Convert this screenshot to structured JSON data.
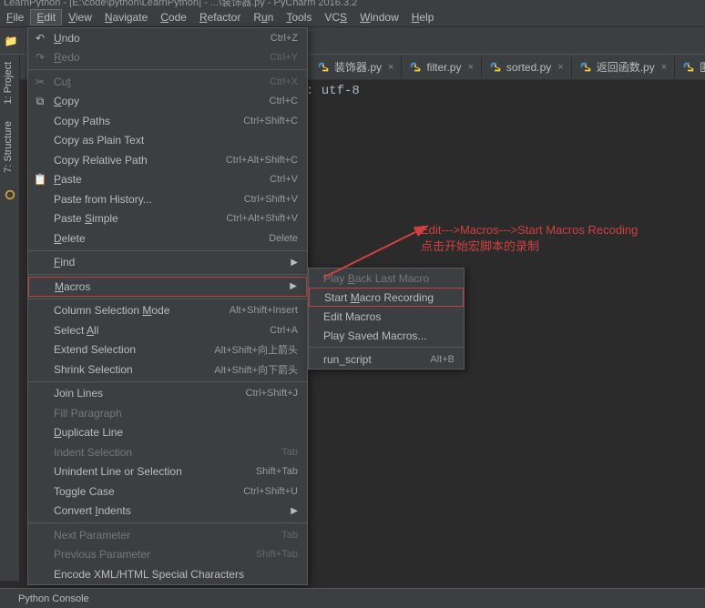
{
  "title": "LearnPython - [E:\\code\\python\\LearnPython] - ...\\装饰器.py - PyCharm 2016.3.2",
  "menubar": [
    "File",
    "Edit",
    "View",
    "Navigate",
    "Code",
    "Refactor",
    "Run",
    "Tools",
    "VCS",
    "Window",
    "Help"
  ],
  "menubar_underline": [
    "F",
    "E",
    "V",
    "N",
    "C",
    "R",
    "u",
    "T",
    "S",
    "W",
    "H"
  ],
  "tabs": [
    {
      "label": "装饰器.py"
    },
    {
      "label": "filter.py"
    },
    {
      "label": "sorted.py"
    },
    {
      "label": "返回函数.py"
    },
    {
      "label": "匿"
    }
  ],
  "editor_text": ": utf-8",
  "sidebar": {
    "project": "1: Project",
    "structure": "7: Structure"
  },
  "bottom": {
    "console": "Python Console"
  },
  "edit_menu": [
    {
      "label": "Undo",
      "u": "U",
      "shortcut": "Ctrl+Z",
      "icon": "undo",
      "sep": false
    },
    {
      "label": "Redo",
      "u": "R",
      "shortcut": "Ctrl+Y",
      "icon": "redo",
      "disabled": true,
      "sep": true
    },
    {
      "label": "Cut",
      "u": "t",
      "shortcut": "Ctrl+X",
      "icon": "cut",
      "disabled": true
    },
    {
      "label": "Copy",
      "u": "C",
      "shortcut": "Ctrl+C",
      "icon": "copy"
    },
    {
      "label": "Copy Paths",
      "shortcut": "Ctrl+Shift+C"
    },
    {
      "label": "Copy as Plain Text"
    },
    {
      "label": "Copy Relative Path",
      "shortcut": "Ctrl+Alt+Shift+C"
    },
    {
      "label": "Paste",
      "u": "P",
      "shortcut": "Ctrl+V",
      "icon": "paste"
    },
    {
      "label": "Paste from History...",
      "shortcut": "Ctrl+Shift+V"
    },
    {
      "label": "Paste Simple",
      "u": "S",
      "shortcut": "Ctrl+Alt+Shift+V"
    },
    {
      "label": "Delete",
      "u": "D",
      "shortcut": "Delete",
      "sep": true
    },
    {
      "label": "Find",
      "u": "F",
      "arrow": true,
      "sep": true
    },
    {
      "label": "Macros",
      "u": "M",
      "arrow": true,
      "hl": true,
      "sep": true
    },
    {
      "label": "Column Selection Mode",
      "u": "M",
      "shortcut": "Alt+Shift+Insert"
    },
    {
      "label": "Select All",
      "u": "A",
      "shortcut": "Ctrl+A"
    },
    {
      "label": "Extend Selection",
      "shortcut": "Alt+Shift+向上箭头"
    },
    {
      "label": "Shrink Selection",
      "shortcut": "Alt+Shift+向下箭头",
      "sep": true
    },
    {
      "label": "Join Lines",
      "shortcut": "Ctrl+Shift+J"
    },
    {
      "label": "Fill Paragraph",
      "disabled": true
    },
    {
      "label": "Duplicate Line",
      "u": "D"
    },
    {
      "label": "Indent Selection",
      "shortcut": "Tab",
      "disabled": true
    },
    {
      "label": "Unindent Line or Selection",
      "shortcut": "Shift+Tab"
    },
    {
      "label": "Toggle Case",
      "shortcut": "Ctrl+Shift+U"
    },
    {
      "label": "Convert Indents",
      "u": "I",
      "arrow": true,
      "sep": true
    },
    {
      "label": "Next Parameter",
      "shortcut": "Tab",
      "disabled": true
    },
    {
      "label": "Previous Parameter",
      "shortcut": "Shift+Tab",
      "disabled": true
    },
    {
      "label": "Encode XML/HTML Special Characters"
    }
  ],
  "macros_submenu": [
    {
      "label": "Play Back Last Macro",
      "u": "B",
      "disabled": true
    },
    {
      "label": "Start Macro Recording",
      "u": "M",
      "sel": true
    },
    {
      "label": "Edit Macros"
    },
    {
      "label": "Play Saved Macros...",
      "sep": true
    },
    {
      "label": "run_script",
      "shortcut": "Alt+B"
    }
  ],
  "annotation": {
    "l1": "Edit--->Macros--->Start Macros Recoding",
    "l2": "点击开始宏脚本的录制"
  }
}
